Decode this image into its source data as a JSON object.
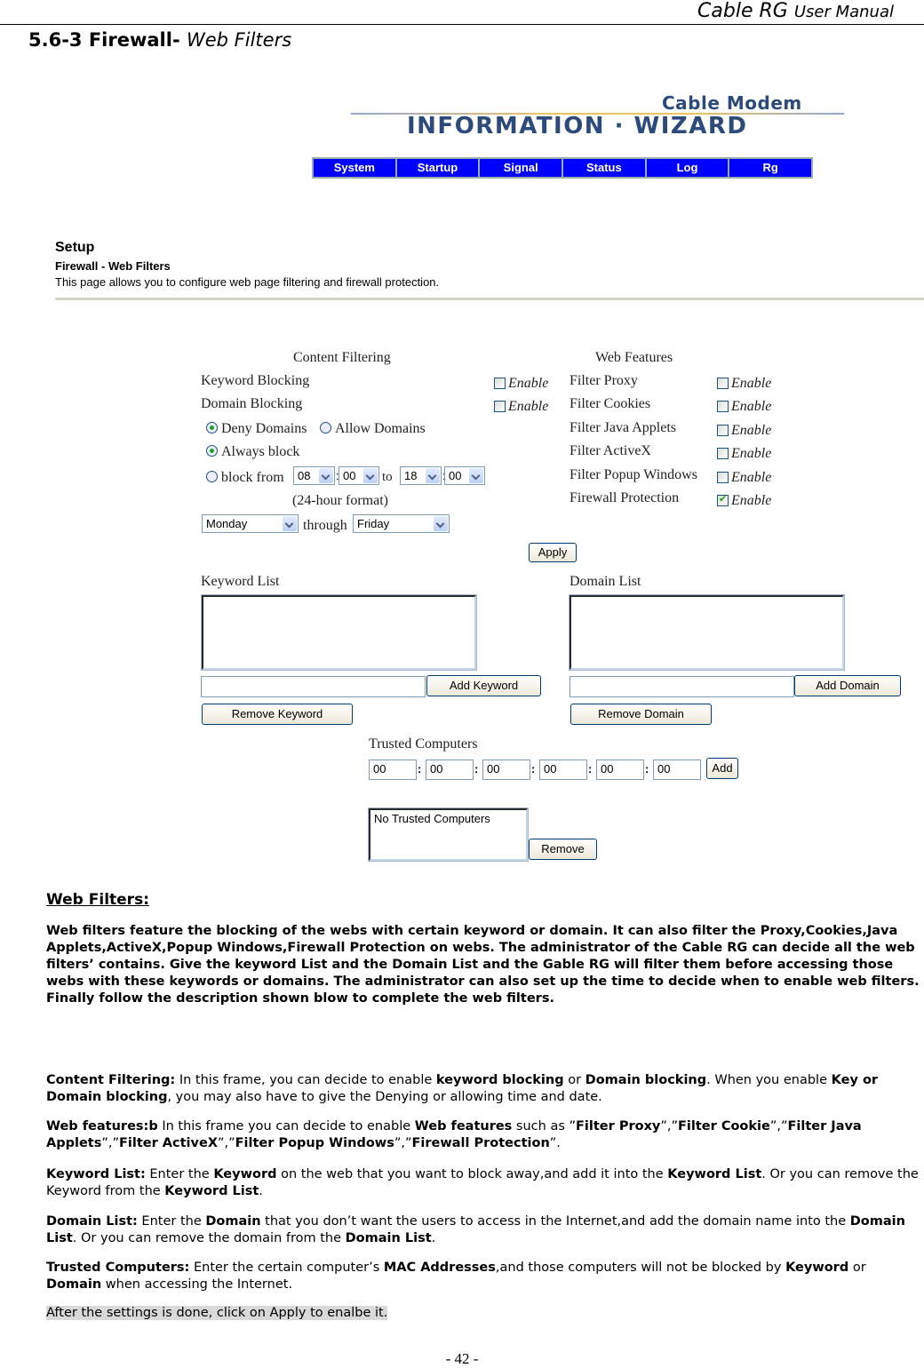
{
  "header": {
    "doc_title_main": "Cable RG",
    "doc_title_sub": "User Manual",
    "section_number": "5.6-3 Firewall-",
    "section_name": "Web Filters"
  },
  "banner": {
    "brand_top": "Cable Modem",
    "brand_main": "INFORMATION · WIZARD",
    "nav": [
      "System",
      "Startup",
      "Signal",
      "Status",
      "Log",
      "Rg"
    ]
  },
  "setup": {
    "heading": "Setup",
    "subheading": "Firewall - Web Filters",
    "description": "This page allows you to configure web page filtering and firewall protection."
  },
  "content_filtering": {
    "title": "Content Filtering",
    "keyword_blocking": {
      "label": "Keyword Blocking",
      "enable_label": "Enable",
      "checked": false
    },
    "domain_blocking": {
      "label": "Domain Blocking",
      "enable_label": "Enable",
      "checked": false
    },
    "deny_domains": {
      "label": "Deny Domains",
      "selected": true
    },
    "allow_domains": {
      "label": "Allow Domains",
      "selected": false
    },
    "always_block": {
      "label": "Always block",
      "selected": true
    },
    "block_from": {
      "label": "block from",
      "selected": false
    },
    "from_hour": "08",
    "from_min": "00",
    "to_label": "to",
    "to_hour": "18",
    "to_min": "00",
    "format_note": "(24-hour format)",
    "day_from": "Monday",
    "through_label": "through",
    "day_to": "Friday"
  },
  "web_features": {
    "title": "Web Features",
    "items": [
      {
        "label": "Filter Proxy",
        "enable_label": "Enable",
        "checked": false
      },
      {
        "label": "Filter Cookies",
        "enable_label": "Enable",
        "checked": false
      },
      {
        "label": "Filter Java Applets",
        "enable_label": "Enable",
        "checked": false
      },
      {
        "label": "Filter ActiveX",
        "enable_label": "Enable",
        "checked": false
      },
      {
        "label": "Filter Popup Windows",
        "enable_label": "Enable",
        "checked": false
      },
      {
        "label": "Firewall Protection",
        "enable_label": "Enable",
        "checked": true
      }
    ]
  },
  "apply_label": "Apply",
  "keyword_list": {
    "title": "Keyword List",
    "input_value": "",
    "add_label": "Add Keyword",
    "remove_label": "Remove Keyword"
  },
  "domain_list": {
    "title": "Domain List",
    "input_value": "",
    "add_label": "Add Domain",
    "remove_label": "Remove Domain"
  },
  "trusted": {
    "title": "Trusted Computers",
    "mac": [
      "00",
      "00",
      "00",
      "00",
      "00",
      "00"
    ],
    "separator": ":",
    "add_label": "Add",
    "list_items": [
      "No Trusted Computers"
    ],
    "remove_label": "Remove"
  },
  "doc": {
    "wf_title": "Web Filters:",
    "wf_para": "Web filters feature the blocking of the webs with certain keyword or domain. It can also filter the Proxy,Cookies,Java Applets,ActiveX,Popup Windows,Firewall Protection on webs. The administrator of the Cable RG can decide all the web filters’ contains. Give the keyword List and the Domain List and the Gable RG will filter them before accessing those webs with these keywords or domains. The administrator can also set up the time to decide when to enable web filters. Finally follow the description shown blow to complete the web filters.",
    "cf": {
      "label": "Content Filtering:",
      "t1": " In this frame, you can decide to enable ",
      "b1": "keyword blocking",
      "t2": " or ",
      "b2": "Domain blocking",
      "t3": ". When you enable ",
      "b3": "Key or Domain blocking",
      "t4": ", you may also have to give the Denying or allowing time and date."
    },
    "wf": {
      "label": "Web features:b",
      "t1": " In this frame you can decide to enable ",
      "b1": "Web features",
      "t2": " such as ”",
      "b2": "Filter Proxy",
      "t3": "”,”",
      "b3": "Filter Cookie",
      "t4": "”,”",
      "b4": "Filter Java Applets",
      "t5": "”,”",
      "b5": "Filter ActiveX",
      "t6": "”,”",
      "b6": "Filter Popup Windows",
      "t7": "”,”",
      "b7": "Firewall Protection",
      "t8": "”."
    },
    "kl": {
      "label": "Keyword List:",
      "t1": " Enter the ",
      "b1": "Keyword",
      "t2": " on the web that you want to block away,and add it into the ",
      "b2": "Keyword List",
      "t3": ". Or you can remove the Keyword from the ",
      "b3": "Keyword List",
      "t4": "."
    },
    "dl": {
      "label": "Domain List:",
      "t1": " Enter the ",
      "b1": "Domain",
      "t2": " that you don’t want the users to access in the Internet,and add the domain name into the ",
      "b2": "Domain List",
      "t3": ". Or you can remove the domain from the ",
      "b3": "Domain List",
      "t4": "."
    },
    "tc": {
      "label": "Trusted Computers:",
      "t1": " Enter the certain computer’s ",
      "b1": "MAC Addresses",
      "t2": ",and those computers will not be blocked by ",
      "b2": "Keyword",
      "t3": " or ",
      "b3": "Domain",
      "t4": " when accessing the Internet."
    },
    "final_note": "After the settings is done, click on Apply to enalbe it.",
    "page_number": "- 42 -"
  }
}
